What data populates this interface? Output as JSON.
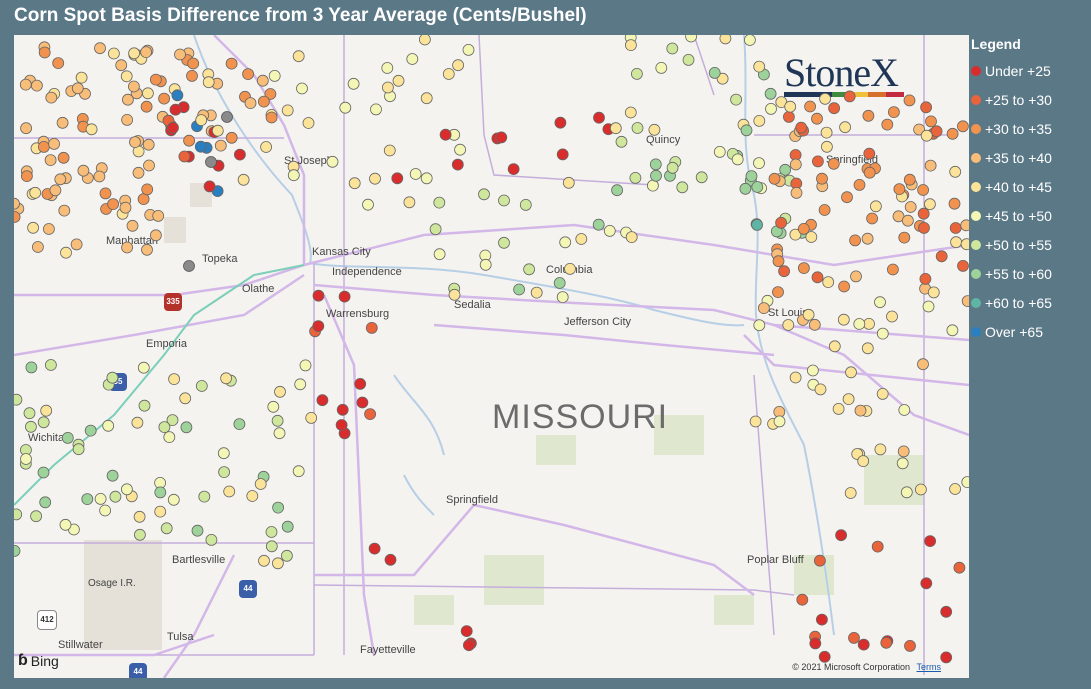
{
  "title": "Corn Spot Basis Difference from 3 Year Average (Cents/Bushel)",
  "legend": {
    "title": "Legend",
    "items": [
      {
        "label": "Under +25",
        "color": "#d92d2d"
      },
      {
        "label": "+25 to +30",
        "color": "#e9643b"
      },
      {
        "label": "+30 to +35",
        "color": "#f1934f"
      },
      {
        "label": "+35 to +40",
        "color": "#f7bd79"
      },
      {
        "label": "+40 to +45",
        "color": "#fbe499"
      },
      {
        "label": "+45 to +50",
        "color": "#f4f6b6"
      },
      {
        "label": "+50 to +55",
        "color": "#cfe79d"
      },
      {
        "label": "+55 to +60",
        "color": "#9dd29a"
      },
      {
        "label": "+60 to +65",
        "color": "#5fb4a4"
      },
      {
        "label": "Over +65",
        "color": "#2a7fc0"
      }
    ]
  },
  "map": {
    "state_label": "MISSOURI",
    "cities": [
      "St Joseph",
      "Manhattan",
      "Topeka",
      "Kansas City",
      "Independence",
      "Olathe",
      "Emporia",
      "Warrensburg",
      "Sedalia",
      "Columbia",
      "Jefferson City",
      "St Louis",
      "Quincy",
      "Springfield",
      "Springfield",
      "Wichita",
      "Bartlesville",
      "Osage I.R.",
      "Tulsa",
      "Stillwater",
      "Fayetteville",
      "Poplar Bluff"
    ],
    "highways": [
      "335",
      "35",
      "44",
      "412",
      "44"
    ]
  },
  "logo": {
    "text": "StoneX"
  },
  "attribution": {
    "bing": "Bing",
    "copyright": "© 2021 Microsoft Corporation",
    "terms": "Terms"
  }
}
